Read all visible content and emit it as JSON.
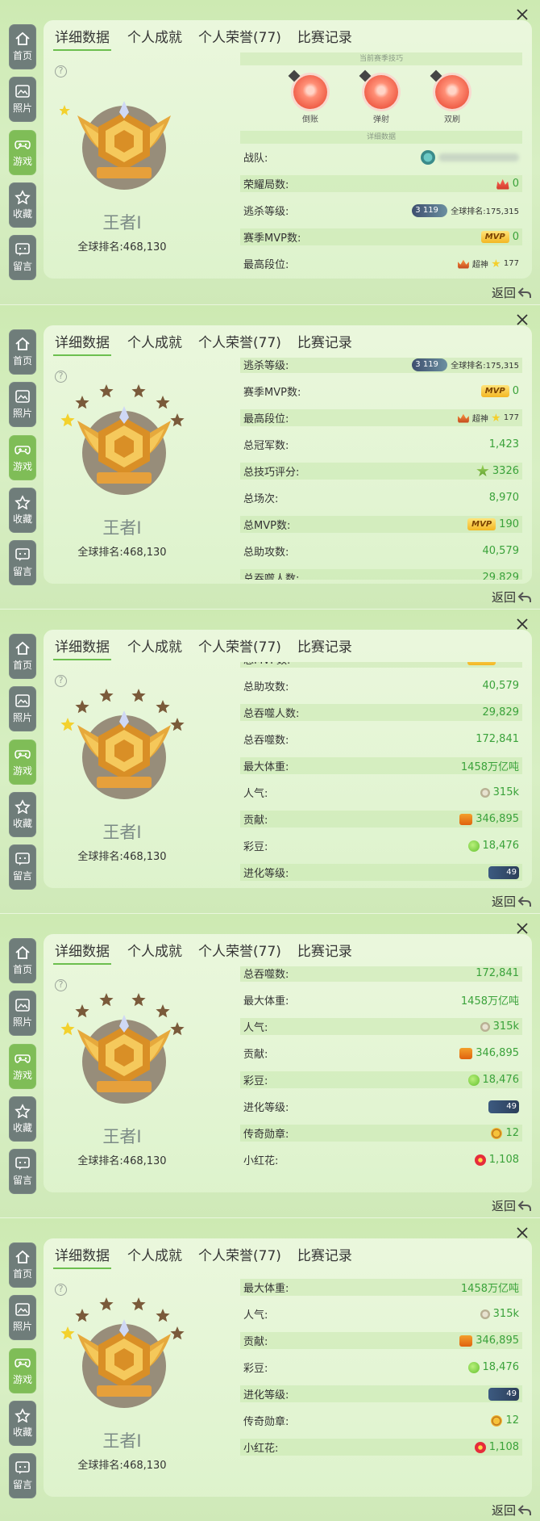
{
  "ui": {
    "close": "×",
    "help": "?",
    "back": "返回",
    "nav": [
      {
        "label": "首页",
        "icon": "home-icon"
      },
      {
        "label": "照片",
        "icon": "photo-icon"
      },
      {
        "label": "游戏",
        "icon": "gamepad-icon"
      },
      {
        "label": "收藏",
        "icon": "star-bookmark-icon"
      },
      {
        "label": "留言",
        "icon": "message-icon"
      }
    ],
    "tabs": [
      "详细数据",
      "个人成就",
      "个人荣誉(77)",
      "比赛记录"
    ],
    "rank_title": "王者Ⅰ",
    "rank_global": "全球排名:468,130"
  },
  "skills_header": "当前赛季技巧",
  "skills": [
    "倒账",
    "弹射",
    "双刷"
  ],
  "details_header": "详细数据",
  "stats": {
    "team": {
      "label": "战队:"
    },
    "honor": {
      "label": "荣耀局数:",
      "value": "0"
    },
    "kill": {
      "label": "逃杀等级:",
      "badge": "3",
      "level": "119",
      "rank": "全球排名:175,315"
    },
    "mvp": {
      "label": "赛季MVP数:",
      "badge": "MVP",
      "value": "0"
    },
    "top": {
      "label": "最高段位:",
      "tier": "超神",
      "value": "177"
    },
    "champion": {
      "label": "总冠军数:",
      "value": "1,423"
    },
    "skill_score": {
      "label": "总技巧评分:",
      "value": "3326"
    },
    "games": {
      "label": "总场次:",
      "value": "8,970"
    },
    "total_mvp": {
      "label": "总MVP数:",
      "badge": "MVP",
      "value": "190"
    },
    "assist": {
      "label": "总助攻数:",
      "value": "40,579"
    },
    "devour_people": {
      "label": "总吞噬人数:",
      "value": "29,829"
    },
    "devour": {
      "label": "总吞噬数:",
      "value": "172,841"
    },
    "weight": {
      "label": "最大体重:",
      "value": "1458万亿吨"
    },
    "pop": {
      "label": "人气:",
      "value": "315k"
    },
    "contrib": {
      "label": "贡献:",
      "value": "346,895"
    },
    "bean": {
      "label": "彩豆:",
      "value": "18,476"
    },
    "evo": {
      "label": "进化等级:",
      "value": "49"
    },
    "legend": {
      "label": "传奇勋章:",
      "value": "12"
    },
    "flower": {
      "label": "小红花:",
      "value": "1,108"
    }
  }
}
